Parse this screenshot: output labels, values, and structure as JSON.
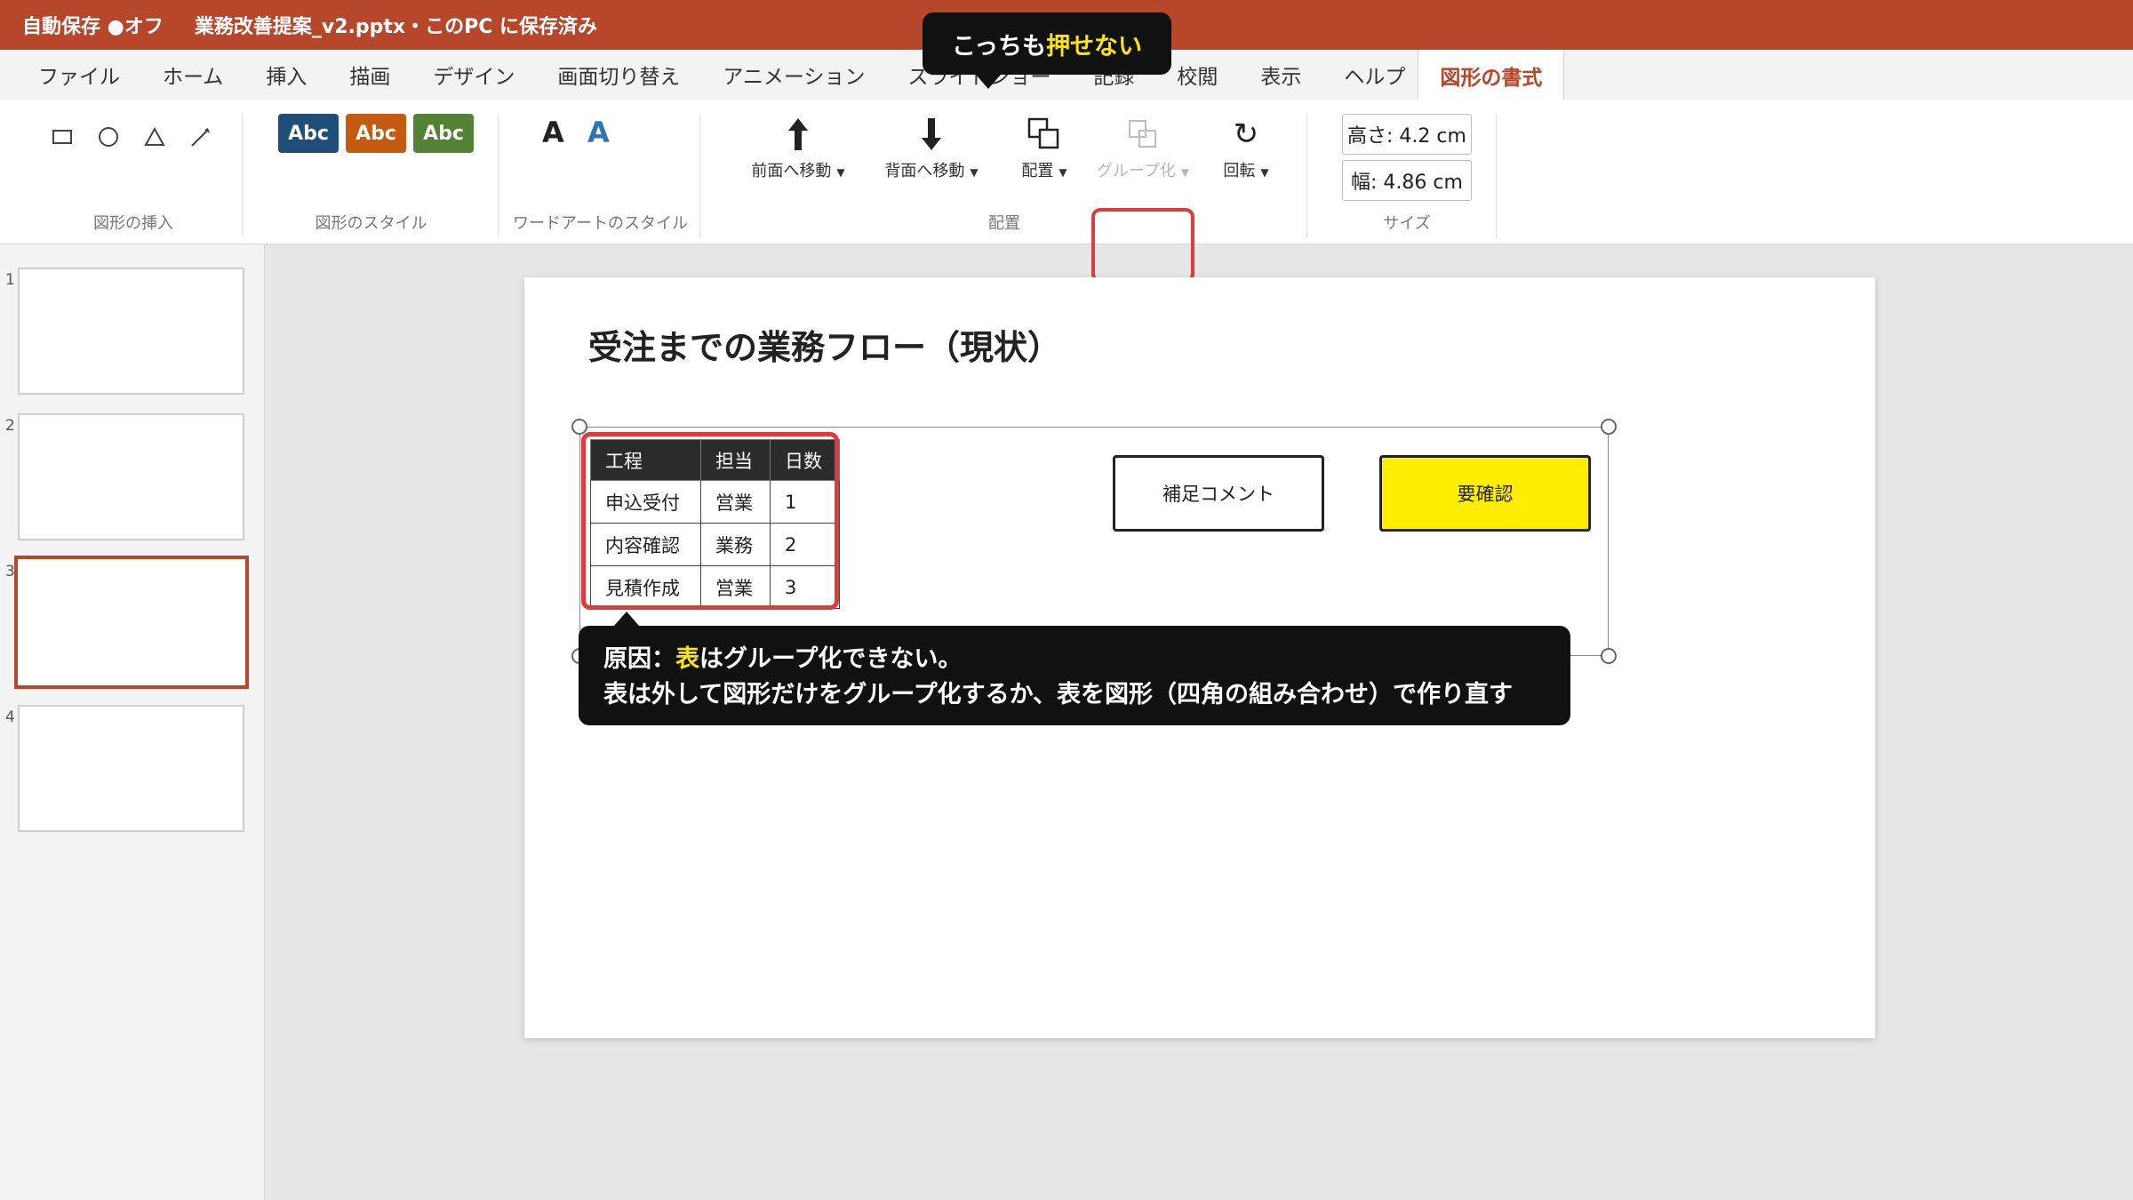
{
  "titlebar": {
    "autosave": "自動保存 ●オフ",
    "filename": "業務改善提案_v2.pptx・このPC に保存済み"
  },
  "tabs": [
    "ファイル",
    "ホーム",
    "挿入",
    "描画",
    "デザイン",
    "画面切り替え",
    "アニメーション",
    "スライドショー",
    "記録",
    "校閲",
    "表示",
    "ヘルプ"
  ],
  "active_tab": "図形の書式",
  "ribbon": {
    "insert_group_label": "図形の挿入",
    "style_group_label": "図形のスタイル",
    "style_buttons": [
      "Abc",
      "Abc",
      "Abc"
    ],
    "wordart_group_label": "ワードアートのスタイル",
    "wordart_a1": "A",
    "wordart_a2": "A",
    "arrange_group_label": "配置",
    "bring_forward": "前面へ移動",
    "send_backward": "背面へ移動",
    "align": "配置",
    "group": "グループ化",
    "rotate": "回転",
    "size_group_label": "サイズ",
    "height": "高さ: 4.2 cm",
    "width": "幅: 4.86 cm"
  },
  "thumbnails": [
    "1",
    "2",
    "3",
    "4"
  ],
  "slide": {
    "title": "受注までの業務フロー（現状）",
    "table": {
      "headers": [
        "工程",
        "担当",
        "日数"
      ],
      "rows": [
        [
          "申込受付",
          "営業",
          "1"
        ],
        [
          "内容確認",
          "業務",
          "2"
        ],
        [
          "見積作成",
          "営業",
          "3"
        ]
      ]
    },
    "box_comment": "補足コメント",
    "box_confirm": "要確認"
  },
  "callout_top": {
    "text_a": "こっちも",
    "text_b": "押せない"
  },
  "callout_main": {
    "line1_a": "原因：",
    "line1_b": "表",
    "line1_c": "はグループ化できない。",
    "line2": "表は外して図形だけをグループ化するか、表を図形（四角の組み合わせ）で作り直す"
  },
  "colors": {
    "accent": "#b7472a",
    "style_blue": "#1f4e79",
    "style_orange": "#c55a11",
    "style_green": "#548235",
    "highlight": "#e03b3b",
    "yellow": "#ffe600"
  }
}
